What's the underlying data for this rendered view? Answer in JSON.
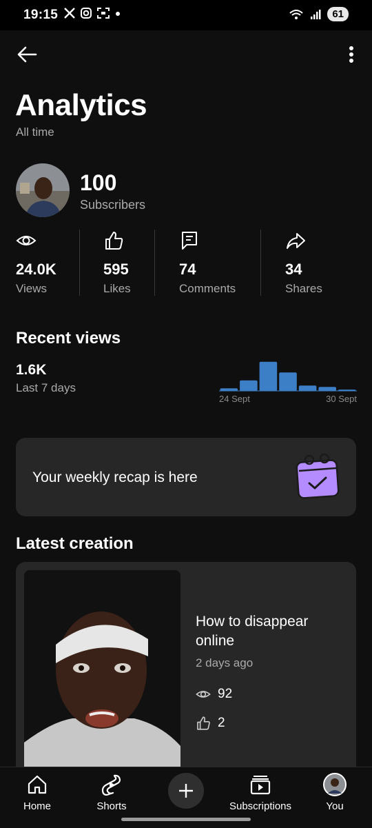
{
  "status": {
    "time": "19:15",
    "left_icons": [
      "x-icon",
      "instagram-icon",
      "scan-icon",
      "dot-icon"
    ],
    "battery": "61"
  },
  "header": {
    "title": "Analytics",
    "subtitle": "All time"
  },
  "channel": {
    "subscribers_count": "100",
    "subscribers_label": "Subscribers"
  },
  "stats": [
    {
      "icon": "eye-icon",
      "value": "24.0K",
      "label": "Views"
    },
    {
      "icon": "thumbs-up-icon",
      "value": "595",
      "label": "Likes"
    },
    {
      "icon": "comment-icon",
      "value": "74",
      "label": "Comments"
    },
    {
      "icon": "share-icon",
      "value": "34",
      "label": "Shares"
    }
  ],
  "recent_views": {
    "title": "Recent views",
    "value": "1.6K",
    "period": "Last 7 days",
    "chart_start": "24 Sept",
    "chart_end": "30 Sept",
    "color": "#3d7fc6"
  },
  "chart_data": {
    "type": "bar",
    "categories": [
      "24 Sept",
      "25",
      "26",
      "27",
      "28",
      "29",
      "30 Sept"
    ],
    "x_tick_labels": [
      "24 Sept",
      "30 Sept"
    ],
    "values": [
      1,
      4,
      11,
      7,
      2,
      1.5,
      0.5
    ],
    "ylim": [
      0,
      12
    ],
    "grid": false
  },
  "recap": {
    "text": "Your weekly recap is here",
    "icon": "calendar-check-icon",
    "icon_color": "#b48cff"
  },
  "latest": {
    "title": "Latest creation",
    "video_title": "How to disappear online",
    "age": "2 days ago",
    "views": "92",
    "likes": "2"
  },
  "nav": {
    "home": "Home",
    "shorts": "Shorts",
    "subscriptions": "Subscriptions",
    "you": "You"
  }
}
